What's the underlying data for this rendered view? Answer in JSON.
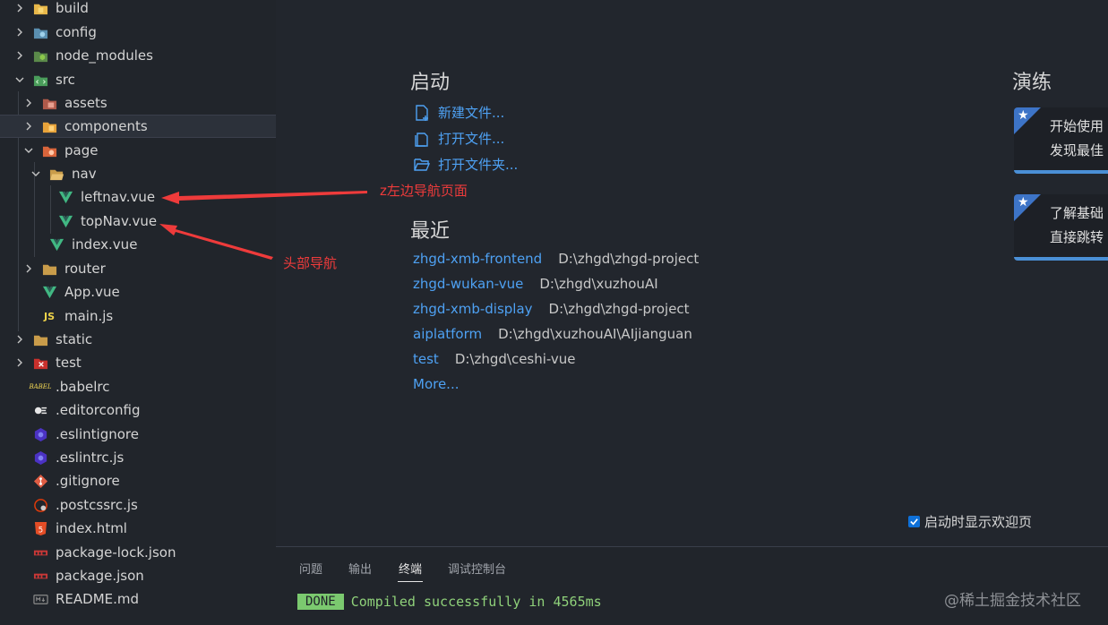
{
  "explorer": {
    "items": [
      {
        "label": "build",
        "icon": "folder-build-icon",
        "expanded": false
      },
      {
        "label": "config",
        "icon": "folder-config-icon",
        "expanded": false
      },
      {
        "label": "node_modules",
        "icon": "folder-node-icon",
        "expanded": false
      },
      {
        "label": "src",
        "icon": "folder-src-icon",
        "expanded": true
      },
      {
        "label": "assets",
        "icon": "folder-assets-icon",
        "expanded": false
      },
      {
        "label": "components",
        "icon": "folder-components-icon",
        "expanded": false,
        "selected": true
      },
      {
        "label": "page",
        "icon": "folder-page-icon",
        "expanded": true
      },
      {
        "label": "nav",
        "icon": "folder-open-icon",
        "expanded": true
      },
      {
        "label": "leftnav.vue",
        "icon": "vue-file-icon"
      },
      {
        "label": "topNav.vue",
        "icon": "vue-file-icon"
      },
      {
        "label": "index.vue",
        "icon": "vue-file-icon"
      },
      {
        "label": "router",
        "icon": "folder-icon",
        "expanded": false
      },
      {
        "label": "App.vue",
        "icon": "vue-file-icon"
      },
      {
        "label": "main.js",
        "icon": "js-file-icon"
      },
      {
        "label": "static",
        "icon": "folder-icon",
        "expanded": false
      },
      {
        "label": "test",
        "icon": "folder-test-icon",
        "expanded": false
      },
      {
        "label": ".babelrc",
        "icon": "babel-file-icon"
      },
      {
        "label": ".editorconfig",
        "icon": "editorconfig-file-icon"
      },
      {
        "label": ".eslintignore",
        "icon": "eslint-file-icon"
      },
      {
        "label": ".eslintrc.js",
        "icon": "eslint-file-icon"
      },
      {
        "label": ".gitignore",
        "icon": "git-file-icon"
      },
      {
        "label": ".postcssrc.js",
        "icon": "postcss-file-icon"
      },
      {
        "label": "index.html",
        "icon": "html-file-icon"
      },
      {
        "label": "package-lock.json",
        "icon": "npm-file-icon"
      },
      {
        "label": "package.json",
        "icon": "npm-file-icon"
      },
      {
        "label": "README.md",
        "icon": "markdown-file-icon"
      }
    ]
  },
  "welcome": {
    "start_title": "启动",
    "start_links": [
      {
        "label": "新建文件...",
        "icon": "new-file-icon"
      },
      {
        "label": "打开文件...",
        "icon": "open-file-icon"
      },
      {
        "label": "打开文件夹...",
        "icon": "open-folder-icon"
      }
    ],
    "recent_title": "最近",
    "recent": [
      {
        "name": "zhgd-xmb-frontend",
        "path": "D:\\zhgd\\zhgd-project"
      },
      {
        "name": "zhgd-wukan-vue",
        "path": "D:\\zhgd\\xuzhouAI"
      },
      {
        "name": "zhgd-xmb-display",
        "path": "D:\\zhgd\\zhgd-project"
      },
      {
        "name": "aiplatform",
        "path": "D:\\zhgd\\xuzhouAI\\AIjianguan"
      },
      {
        "name": "test",
        "path": "D:\\zhgd\\ceshi-vue"
      }
    ],
    "more_label": "More...",
    "walkthrough_title": "演练",
    "cards": [
      {
        "line1": "开始使用",
        "line2": "发现最佳"
      },
      {
        "line1": "了解基础",
        "line2": "直接跳转"
      }
    ],
    "show_on_startup": "启动时显示欢迎页",
    "show_on_startup_checked": true
  },
  "panel": {
    "tabs": [
      "问题",
      "输出",
      "终端",
      "调试控制台"
    ],
    "active_tab": "终端",
    "badge": "DONE",
    "message": "Compiled successfully in 4565ms"
  },
  "annotations": {
    "left_nav_note": "z左边导航页面",
    "top_nav_note": "头部导航"
  },
  "watermark": "@稀土掘金技术社区",
  "colors": {
    "link": "#4ea1f3",
    "annotation": "#ee3b3b",
    "done_badge": "#7bc96f",
    "vue": "#41b883"
  }
}
